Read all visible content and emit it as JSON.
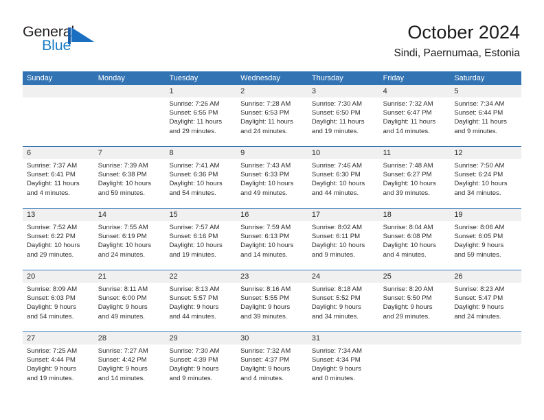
{
  "brand": {
    "name_part1": "General",
    "name_part2": "Blue",
    "mark": "triangle-flag-logo",
    "color_dark": "#231f20",
    "color_blue": "#1a7dc4"
  },
  "header": {
    "title": "October 2024",
    "subtitle": "Sindi, Paernumaa, Estonia"
  },
  "theme": {
    "header_blue": "#3273b3",
    "date_band_gray": "#f0f0f0",
    "text": "#2b2b2b"
  },
  "calendar": {
    "weekday_headers": [
      "Sunday",
      "Monday",
      "Tuesday",
      "Wednesday",
      "Thursday",
      "Friday",
      "Saturday"
    ],
    "weeks": [
      [
        {
          "day": "",
          "lines": []
        },
        {
          "day": "",
          "lines": []
        },
        {
          "day": "1",
          "lines": [
            "Sunrise: 7:26 AM",
            "Sunset: 6:55 PM",
            "Daylight: 11 hours",
            "and 29 minutes."
          ]
        },
        {
          "day": "2",
          "lines": [
            "Sunrise: 7:28 AM",
            "Sunset: 6:53 PM",
            "Daylight: 11 hours",
            "and 24 minutes."
          ]
        },
        {
          "day": "3",
          "lines": [
            "Sunrise: 7:30 AM",
            "Sunset: 6:50 PM",
            "Daylight: 11 hours",
            "and 19 minutes."
          ]
        },
        {
          "day": "4",
          "lines": [
            "Sunrise: 7:32 AM",
            "Sunset: 6:47 PM",
            "Daylight: 11 hours",
            "and 14 minutes."
          ]
        },
        {
          "day": "5",
          "lines": [
            "Sunrise: 7:34 AM",
            "Sunset: 6:44 PM",
            "Daylight: 11 hours",
            "and 9 minutes."
          ]
        }
      ],
      [
        {
          "day": "6",
          "lines": [
            "Sunrise: 7:37 AM",
            "Sunset: 6:41 PM",
            "Daylight: 11 hours",
            "and 4 minutes."
          ]
        },
        {
          "day": "7",
          "lines": [
            "Sunrise: 7:39 AM",
            "Sunset: 6:38 PM",
            "Daylight: 10 hours",
            "and 59 minutes."
          ]
        },
        {
          "day": "8",
          "lines": [
            "Sunrise: 7:41 AM",
            "Sunset: 6:36 PM",
            "Daylight: 10 hours",
            "and 54 minutes."
          ]
        },
        {
          "day": "9",
          "lines": [
            "Sunrise: 7:43 AM",
            "Sunset: 6:33 PM",
            "Daylight: 10 hours",
            "and 49 minutes."
          ]
        },
        {
          "day": "10",
          "lines": [
            "Sunrise: 7:46 AM",
            "Sunset: 6:30 PM",
            "Daylight: 10 hours",
            "and 44 minutes."
          ]
        },
        {
          "day": "11",
          "lines": [
            "Sunrise: 7:48 AM",
            "Sunset: 6:27 PM",
            "Daylight: 10 hours",
            "and 39 minutes."
          ]
        },
        {
          "day": "12",
          "lines": [
            "Sunrise: 7:50 AM",
            "Sunset: 6:24 PM",
            "Daylight: 10 hours",
            "and 34 minutes."
          ]
        }
      ],
      [
        {
          "day": "13",
          "lines": [
            "Sunrise: 7:52 AM",
            "Sunset: 6:22 PM",
            "Daylight: 10 hours",
            "and 29 minutes."
          ]
        },
        {
          "day": "14",
          "lines": [
            "Sunrise: 7:55 AM",
            "Sunset: 6:19 PM",
            "Daylight: 10 hours",
            "and 24 minutes."
          ]
        },
        {
          "day": "15",
          "lines": [
            "Sunrise: 7:57 AM",
            "Sunset: 6:16 PM",
            "Daylight: 10 hours",
            "and 19 minutes."
          ]
        },
        {
          "day": "16",
          "lines": [
            "Sunrise: 7:59 AM",
            "Sunset: 6:13 PM",
            "Daylight: 10 hours",
            "and 14 minutes."
          ]
        },
        {
          "day": "17",
          "lines": [
            "Sunrise: 8:02 AM",
            "Sunset: 6:11 PM",
            "Daylight: 10 hours",
            "and 9 minutes."
          ]
        },
        {
          "day": "18",
          "lines": [
            "Sunrise: 8:04 AM",
            "Sunset: 6:08 PM",
            "Daylight: 10 hours",
            "and 4 minutes."
          ]
        },
        {
          "day": "19",
          "lines": [
            "Sunrise: 8:06 AM",
            "Sunset: 6:05 PM",
            "Daylight: 9 hours",
            "and 59 minutes."
          ]
        }
      ],
      [
        {
          "day": "20",
          "lines": [
            "Sunrise: 8:09 AM",
            "Sunset: 6:03 PM",
            "Daylight: 9 hours",
            "and 54 minutes."
          ]
        },
        {
          "day": "21",
          "lines": [
            "Sunrise: 8:11 AM",
            "Sunset: 6:00 PM",
            "Daylight: 9 hours",
            "and 49 minutes."
          ]
        },
        {
          "day": "22",
          "lines": [
            "Sunrise: 8:13 AM",
            "Sunset: 5:57 PM",
            "Daylight: 9 hours",
            "and 44 minutes."
          ]
        },
        {
          "day": "23",
          "lines": [
            "Sunrise: 8:16 AM",
            "Sunset: 5:55 PM",
            "Daylight: 9 hours",
            "and 39 minutes."
          ]
        },
        {
          "day": "24",
          "lines": [
            "Sunrise: 8:18 AM",
            "Sunset: 5:52 PM",
            "Daylight: 9 hours",
            "and 34 minutes."
          ]
        },
        {
          "day": "25",
          "lines": [
            "Sunrise: 8:20 AM",
            "Sunset: 5:50 PM",
            "Daylight: 9 hours",
            "and 29 minutes."
          ]
        },
        {
          "day": "26",
          "lines": [
            "Sunrise: 8:23 AM",
            "Sunset: 5:47 PM",
            "Daylight: 9 hours",
            "and 24 minutes."
          ]
        }
      ],
      [
        {
          "day": "27",
          "lines": [
            "Sunrise: 7:25 AM",
            "Sunset: 4:44 PM",
            "Daylight: 9 hours",
            "and 19 minutes."
          ]
        },
        {
          "day": "28",
          "lines": [
            "Sunrise: 7:27 AM",
            "Sunset: 4:42 PM",
            "Daylight: 9 hours",
            "and 14 minutes."
          ]
        },
        {
          "day": "29",
          "lines": [
            "Sunrise: 7:30 AM",
            "Sunset: 4:39 PM",
            "Daylight: 9 hours",
            "and 9 minutes."
          ]
        },
        {
          "day": "30",
          "lines": [
            "Sunrise: 7:32 AM",
            "Sunset: 4:37 PM",
            "Daylight: 9 hours",
            "and 4 minutes."
          ]
        },
        {
          "day": "31",
          "lines": [
            "Sunrise: 7:34 AM",
            "Sunset: 4:34 PM",
            "Daylight: 9 hours",
            "and 0 minutes."
          ]
        },
        {
          "day": "",
          "lines": []
        },
        {
          "day": "",
          "lines": []
        }
      ]
    ]
  }
}
